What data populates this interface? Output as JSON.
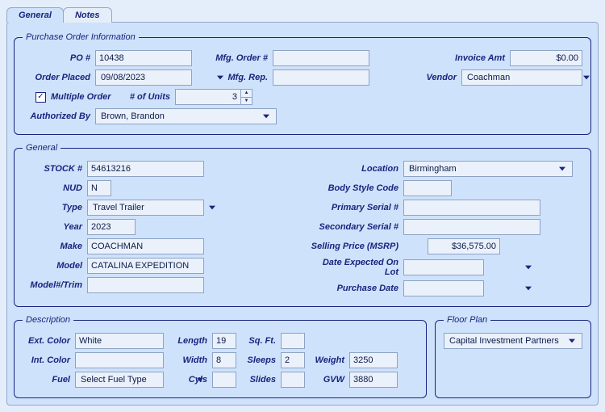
{
  "tabs": {
    "general": "General",
    "notes": "Notes"
  },
  "po_info": {
    "legend": "Purchase Order Information",
    "po_label": "PO #",
    "po_value": "10438",
    "mfg_order_label": "Mfg. Order #",
    "mfg_order_value": "",
    "invoice_label": "Invoice Amt",
    "invoice_value": "$0.00",
    "placed_label": "Order Placed",
    "placed_value": "09/08/2023",
    "mfg_rep_label": "Mfg. Rep.",
    "mfg_rep_value": "",
    "vendor_label": "Vendor",
    "vendor_value": "Coachman",
    "multi_label": "Multiple Order",
    "multi_checked": "✓",
    "units_label": "# of Units",
    "units_value": "3",
    "auth_label": "Authorized By",
    "auth_value": "Brown, Brandon"
  },
  "general": {
    "legend": "General",
    "stock_label": "STOCK #",
    "stock_value": "54613216",
    "nud_label": "NUD",
    "nud_value": "N",
    "type_label": "Type",
    "type_value": "Travel Trailer",
    "year_label": "Year",
    "year_value": "2023",
    "make_label": "Make",
    "make_value": "COACHMAN",
    "model_label": "Model",
    "model_value": "CATALINA EXPEDITION",
    "trim_label": "Model#/Trim",
    "trim_value": "",
    "location_label": "Location",
    "location_value": "Birmingham",
    "body_label": "Body Style Code",
    "body_value": "",
    "pserial_label": "Primary Serial #",
    "pserial_value": "",
    "sserial_label": "Secondary Serial #",
    "sserial_value": "",
    "msrp_label": "Selling Price (MSRP)",
    "msrp_value": "$36,575.00",
    "expected_label": "Date Expected On Lot",
    "expected_value": "",
    "purchase_label": "Purchase Date",
    "purchase_value": ""
  },
  "desc": {
    "legend": "Description",
    "ext_label": "Ext. Color",
    "ext_value": "White",
    "int_label": "Int. Color",
    "int_value": "",
    "fuel_label": "Fuel",
    "fuel_value": "Select Fuel Type",
    "length_label": "Length",
    "length_value": "19",
    "width_label": "Width",
    "width_value": "8",
    "cyls_label": "Cyls",
    "cyls_value": "",
    "sqft_label": "Sq. Ft.",
    "sqft_value": "",
    "sleeps_label": "Sleeps",
    "sleeps_value": "2",
    "slides_label": "Slides",
    "slides_value": "",
    "weight_label": "Weight",
    "weight_value": "3250",
    "gvw_label": "GVW",
    "gvw_value": "3880"
  },
  "floorplan": {
    "legend": "Floor Plan",
    "value": "Capital Investment Partners"
  }
}
